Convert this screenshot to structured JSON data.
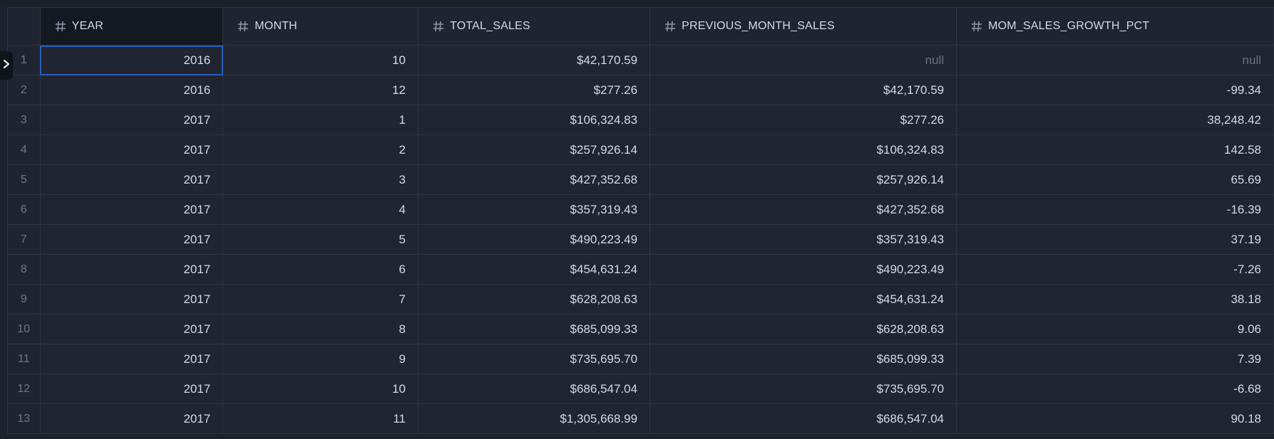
{
  "columns": [
    {
      "label": "YEAR",
      "icon": "hash-icon"
    },
    {
      "label": "MONTH",
      "icon": "hash-icon"
    },
    {
      "label": "TOTAL_SALES",
      "icon": "hash-icon"
    },
    {
      "label": "PREVIOUS_MONTH_SALES",
      "icon": "hash-icon"
    },
    {
      "label": "MOM_SALES_GROWTH_PCT",
      "icon": "hash-icon"
    }
  ],
  "rows": [
    {
      "n": "1",
      "year": "2016",
      "month": "10",
      "total_sales": "$42,170.59",
      "previous_month_sales": "null",
      "mom_sales_growth_pct": "null"
    },
    {
      "n": "2",
      "year": "2016",
      "month": "12",
      "total_sales": "$277.26",
      "previous_month_sales": "$42,170.59",
      "mom_sales_growth_pct": "-99.34"
    },
    {
      "n": "3",
      "year": "2017",
      "month": "1",
      "total_sales": "$106,324.83",
      "previous_month_sales": "$277.26",
      "mom_sales_growth_pct": "38,248.42"
    },
    {
      "n": "4",
      "year": "2017",
      "month": "2",
      "total_sales": "$257,926.14",
      "previous_month_sales": "$106,324.83",
      "mom_sales_growth_pct": "142.58"
    },
    {
      "n": "5",
      "year": "2017",
      "month": "3",
      "total_sales": "$427,352.68",
      "previous_month_sales": "$257,926.14",
      "mom_sales_growth_pct": "65.69"
    },
    {
      "n": "6",
      "year": "2017",
      "month": "4",
      "total_sales": "$357,319.43",
      "previous_month_sales": "$427,352.68",
      "mom_sales_growth_pct": "-16.39"
    },
    {
      "n": "7",
      "year": "2017",
      "month": "5",
      "total_sales": "$490,223.49",
      "previous_month_sales": "$357,319.43",
      "mom_sales_growth_pct": "37.19"
    },
    {
      "n": "8",
      "year": "2017",
      "month": "6",
      "total_sales": "$454,631.24",
      "previous_month_sales": "$490,223.49",
      "mom_sales_growth_pct": "-7.26"
    },
    {
      "n": "9",
      "year": "2017",
      "month": "7",
      "total_sales": "$628,208.63",
      "previous_month_sales": "$454,631.24",
      "mom_sales_growth_pct": "38.18"
    },
    {
      "n": "10",
      "year": "2017",
      "month": "8",
      "total_sales": "$685,099.33",
      "previous_month_sales": "$628,208.63",
      "mom_sales_growth_pct": "9.06"
    },
    {
      "n": "11",
      "year": "2017",
      "month": "9",
      "total_sales": "$735,695.70",
      "previous_month_sales": "$685,099.33",
      "mom_sales_growth_pct": "7.39"
    },
    {
      "n": "12",
      "year": "2017",
      "month": "10",
      "total_sales": "$686,547.04",
      "previous_month_sales": "$735,695.70",
      "mom_sales_growth_pct": "-6.68"
    },
    {
      "n": "13",
      "year": "2017",
      "month": "11",
      "total_sales": "$1,305,668.99",
      "previous_month_sales": "$686,547.04",
      "mom_sales_growth_pct": "90.18"
    }
  ],
  "expand_icon": "chevron-right-icon",
  "colors": {
    "background": "#1c212b",
    "cell": "#202531",
    "border": "#2f3542",
    "text": "#d5d9e1",
    "muted": "#6f7786",
    "selection": "#2a5db8"
  }
}
